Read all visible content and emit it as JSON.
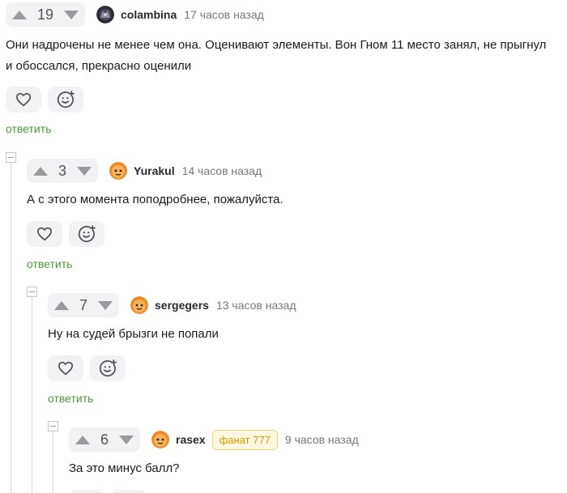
{
  "comments": [
    {
      "votes": "19",
      "author": "colambina",
      "time": "17 часов назад",
      "text_lines": [
        "Они надрочены не менее чем она. Оценивают элементы. Вон Гном 11 место занял, не прыгнул",
        "и обоссался, прекрасно оценили"
      ],
      "reply_label": "ответить"
    },
    {
      "votes": "3",
      "author": "Yurakul",
      "time": "14 часов назад",
      "text_lines": [
        "А с этого момента поподробнее, пожалуйста."
      ],
      "reply_label": "ответить"
    },
    {
      "votes": "7",
      "author": "sergegers",
      "time": "13 часов назад",
      "text_lines": [
        "Ну на судей брызги не попали"
      ],
      "reply_label": "ответить"
    },
    {
      "votes": "6",
      "author": "rasex",
      "badge": "фанат 777",
      "time": "9 часов назад",
      "text_lines": [
        "За это минус балл?"
      ]
    }
  ],
  "icons": {
    "vote_up": "triangle-up-icon",
    "vote_down": "triangle-down-icon",
    "like": "heart-icon",
    "react": "emoji-add-icon",
    "collapse": "minus-box-icon"
  },
  "colors": {
    "reply_link": "#4a9a3a",
    "vote_bg": "#f2f2f4",
    "badge_text": "#d99a00",
    "badge_bg": "#fff8de"
  }
}
